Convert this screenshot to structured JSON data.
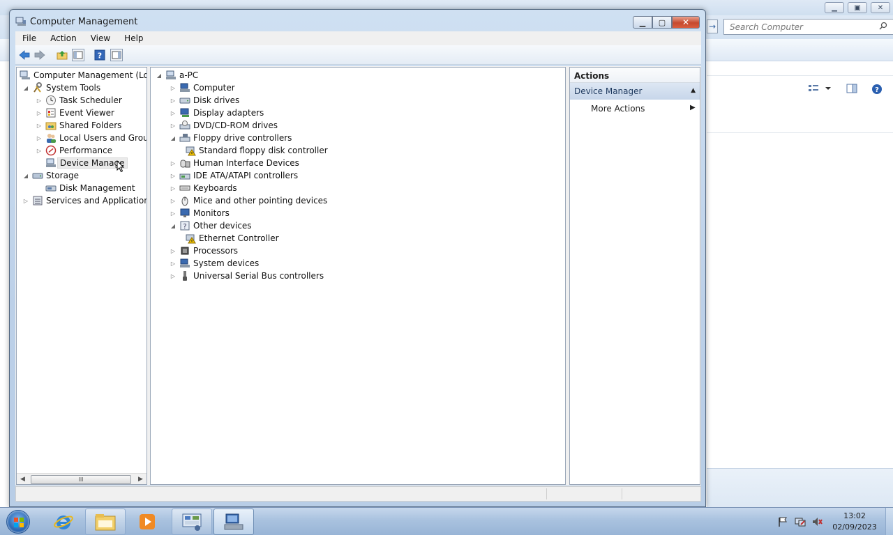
{
  "background_window": {
    "search_placeholder": "Search Computer",
    "buttons": {
      "minimize": "▁",
      "maximize": "▣",
      "close": "✕"
    },
    "nav_arrow": "→",
    "toolbar_icons": [
      "view-options-icon",
      "preview-pane-icon",
      "help-icon"
    ]
  },
  "window": {
    "title": "Computer Management",
    "buttons": {
      "minimize": "▁",
      "maximize": "▢",
      "close": "✕"
    }
  },
  "menubar": {
    "items": [
      "File",
      "Action",
      "View",
      "Help"
    ]
  },
  "toolbar": {
    "icons": [
      "back-arrow-icon",
      "forward-arrow-icon",
      "up-folder-icon",
      "show-hide-console-tree-icon",
      "help-icon",
      "show-hide-action-pane-icon"
    ]
  },
  "left_tree": {
    "root": "Computer Management (Local",
    "system_tools": "System Tools",
    "task_scheduler": "Task Scheduler",
    "event_viewer": "Event Viewer",
    "shared_folders": "Shared Folders",
    "local_users": "Local Users and Groups",
    "performance": "Performance",
    "device_manager": "Device Manage",
    "storage": "Storage",
    "disk_management": "Disk Management",
    "services": "Services and Applications",
    "scroll_grip": "III"
  },
  "device_tree": {
    "root": "a-PC",
    "items": [
      {
        "label": "Computer",
        "expand": "▷",
        "icon": "computer-icon"
      },
      {
        "label": "Disk drives",
        "expand": "▷",
        "icon": "disk-drive-icon"
      },
      {
        "label": "Display adapters",
        "expand": "▷",
        "icon": "display-adapter-icon"
      },
      {
        "label": "DVD/CD-ROM drives",
        "expand": "▷",
        "icon": "dvd-drive-icon"
      },
      {
        "label": "Floppy drive controllers",
        "expand": "◢",
        "icon": "floppy-controller-icon"
      },
      {
        "label": "Standard floppy disk controller",
        "expand": "",
        "icon": "warning-device-icon",
        "child": true
      },
      {
        "label": "Human Interface Devices",
        "expand": "▷",
        "icon": "hid-icon"
      },
      {
        "label": "IDE ATA/ATAPI controllers",
        "expand": "▷",
        "icon": "ide-controller-icon"
      },
      {
        "label": "Keyboards",
        "expand": "▷",
        "icon": "keyboard-icon"
      },
      {
        "label": "Mice and other pointing devices",
        "expand": "▷",
        "icon": "mouse-icon"
      },
      {
        "label": "Monitors",
        "expand": "▷",
        "icon": "monitor-icon"
      },
      {
        "label": "Other devices",
        "expand": "◢",
        "icon": "other-devices-icon"
      },
      {
        "label": "Ethernet Controller",
        "expand": "",
        "icon": "warning-device-icon",
        "child": true
      },
      {
        "label": "Processors",
        "expand": "▷",
        "icon": "processor-icon"
      },
      {
        "label": "System devices",
        "expand": "▷",
        "icon": "system-devices-icon"
      },
      {
        "label": "Universal Serial Bus controllers",
        "expand": "▷",
        "icon": "usb-icon"
      }
    ]
  },
  "actions": {
    "header": "Actions",
    "section": "Device Manager",
    "more_actions": "More Actions"
  },
  "taskbar": {
    "apps": [
      "start-orb-icon",
      "internet-explorer-icon",
      "windows-explorer-icon",
      "media-player-icon",
      "control-panel-icon",
      "computer-management-icon"
    ],
    "tray": [
      "action-center-flag-icon",
      "network-icon",
      "volume-muted-icon"
    ],
    "time": "13:02",
    "date": "02/09/2023"
  }
}
